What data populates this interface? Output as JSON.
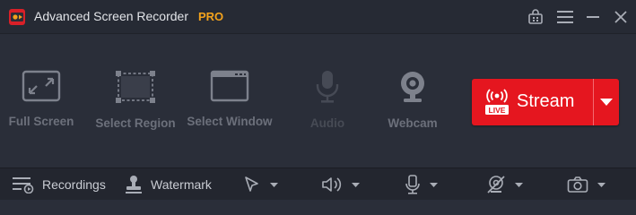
{
  "titlebar": {
    "app_name": "Advanced Screen Recorder",
    "badge": "PRO",
    "logo_icon": "record-logo-icon",
    "controls": [
      "store-icon",
      "menu-icon",
      "minimize-icon",
      "close-icon"
    ]
  },
  "tools": [
    {
      "label": "Full Screen",
      "icon": "fullscreen-icon",
      "enabled": true
    },
    {
      "label": "Select Region",
      "icon": "select-region-icon",
      "enabled": true
    },
    {
      "label": "Select Window",
      "icon": "select-window-icon",
      "enabled": true
    },
    {
      "label": "Audio",
      "icon": "microphone-icon",
      "enabled": false
    },
    {
      "label": "Webcam",
      "icon": "webcam-icon",
      "enabled": true
    }
  ],
  "stream": {
    "label": "Stream",
    "live_badge": "LIVE",
    "dropdown_icon": "chevron-down-icon"
  },
  "bottombar": {
    "recordings_label": "Recordings",
    "watermark_label": "Watermark",
    "dropdowns": [
      "cursor-icon",
      "speaker-icon",
      "microphone-icon",
      "webcam-off-icon",
      "camera-icon"
    ]
  },
  "colors": {
    "accent": "#e5161f",
    "pro": "#f3a21c",
    "background": "#2a2e39",
    "titlebar": "#262a34",
    "bottombar": "#23262f"
  }
}
